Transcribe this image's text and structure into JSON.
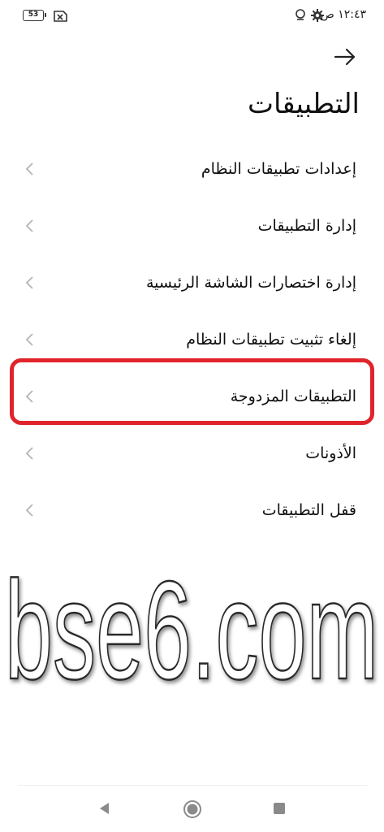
{
  "status_bar": {
    "battery_level": "53",
    "time": "١٢:٤٣ ص",
    "icons": [
      "battery-icon",
      "no-sim-icon",
      "gear-icon",
      "location-icon"
    ]
  },
  "header": {
    "back_icon": "arrow-right-icon",
    "title": "التطبيقات"
  },
  "menu": {
    "items": [
      {
        "label": "إعدادات تطبيقات النظام"
      },
      {
        "label": "إدارة التطبيقات"
      },
      {
        "label": "إدارة اختصارات الشاشة الرئيسية"
      },
      {
        "label": "إلغاء تثبيت تطبيقات النظام"
      },
      {
        "label": "التطبيقات المزدوجة",
        "highlighted": true
      },
      {
        "label": "الأذونات"
      },
      {
        "label": "قفل التطبيقات"
      }
    ],
    "chevron_icon": "chevron-left-icon",
    "highlight_color": "#e0242a"
  },
  "watermark": {
    "text": "bse6.com"
  },
  "nav_bar": {
    "icons": [
      "nav-back-icon",
      "nav-home-icon",
      "nav-recents-icon"
    ]
  }
}
